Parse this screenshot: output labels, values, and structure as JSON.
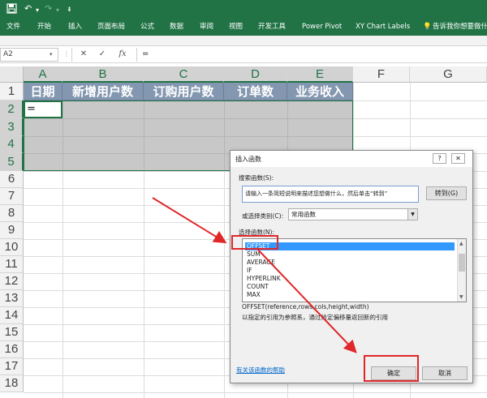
{
  "window": {
    "save_icon": "save-icon",
    "undo_icon": "undo-icon",
    "redo_icon": "redo-icon",
    "customize_icon": "customize-icon"
  },
  "ribbon": {
    "tabs": [
      "文件",
      "开始",
      "插入",
      "页面布局",
      "公式",
      "数据",
      "审阅",
      "视图",
      "开发工具",
      "Power Pivot",
      "XY Chart Labels"
    ],
    "tell_me": "告诉我你想要做什么"
  },
  "formula_bar": {
    "name_box": "A2",
    "cancel": "✕",
    "enter": "✓",
    "fx": "fx",
    "formula": "="
  },
  "sheet": {
    "columns": [
      "A",
      "B",
      "C",
      "D",
      "E",
      "F",
      "G"
    ],
    "rows": [
      "1",
      "2",
      "3",
      "4",
      "5",
      "6",
      "7",
      "8",
      "9",
      "10",
      "11",
      "12",
      "13",
      "14",
      "15",
      "16",
      "17",
      "18"
    ],
    "headers": [
      "日期",
      "新增用户数",
      "订购用户数",
      "订单数",
      "业务收入"
    ],
    "active_cell_value": "="
  },
  "dialog": {
    "title": "插入函数",
    "help_btn": "?",
    "close_btn": "✕",
    "search_label": "搜索函数(S):",
    "search_text": "请输入一条简短说明来描述您想做什么，然后单击“转到”",
    "go_button": "转到(G)",
    "category_label": "或选择类别(C):",
    "category_value": "常用函数",
    "func_label": "选择函数(N):",
    "functions": [
      "OFFSET",
      "SUM",
      "AVERAGE",
      "IF",
      "HYPERLINK",
      "COUNT",
      "MAX"
    ],
    "selected_function": "OFFSET",
    "signature": "OFFSET(reference,rows,cols,height,width)",
    "description": "以指定的引用为参照系，通过给定偏移量返回新的引用",
    "help_link": "有关该函数的帮助",
    "ok": "确定",
    "cancel": "取消"
  },
  "colors": {
    "excel_green": "#217346",
    "header_fill": "#8497b0",
    "annotation_red": "#e0272a",
    "selection_blue": "#3399ff"
  }
}
